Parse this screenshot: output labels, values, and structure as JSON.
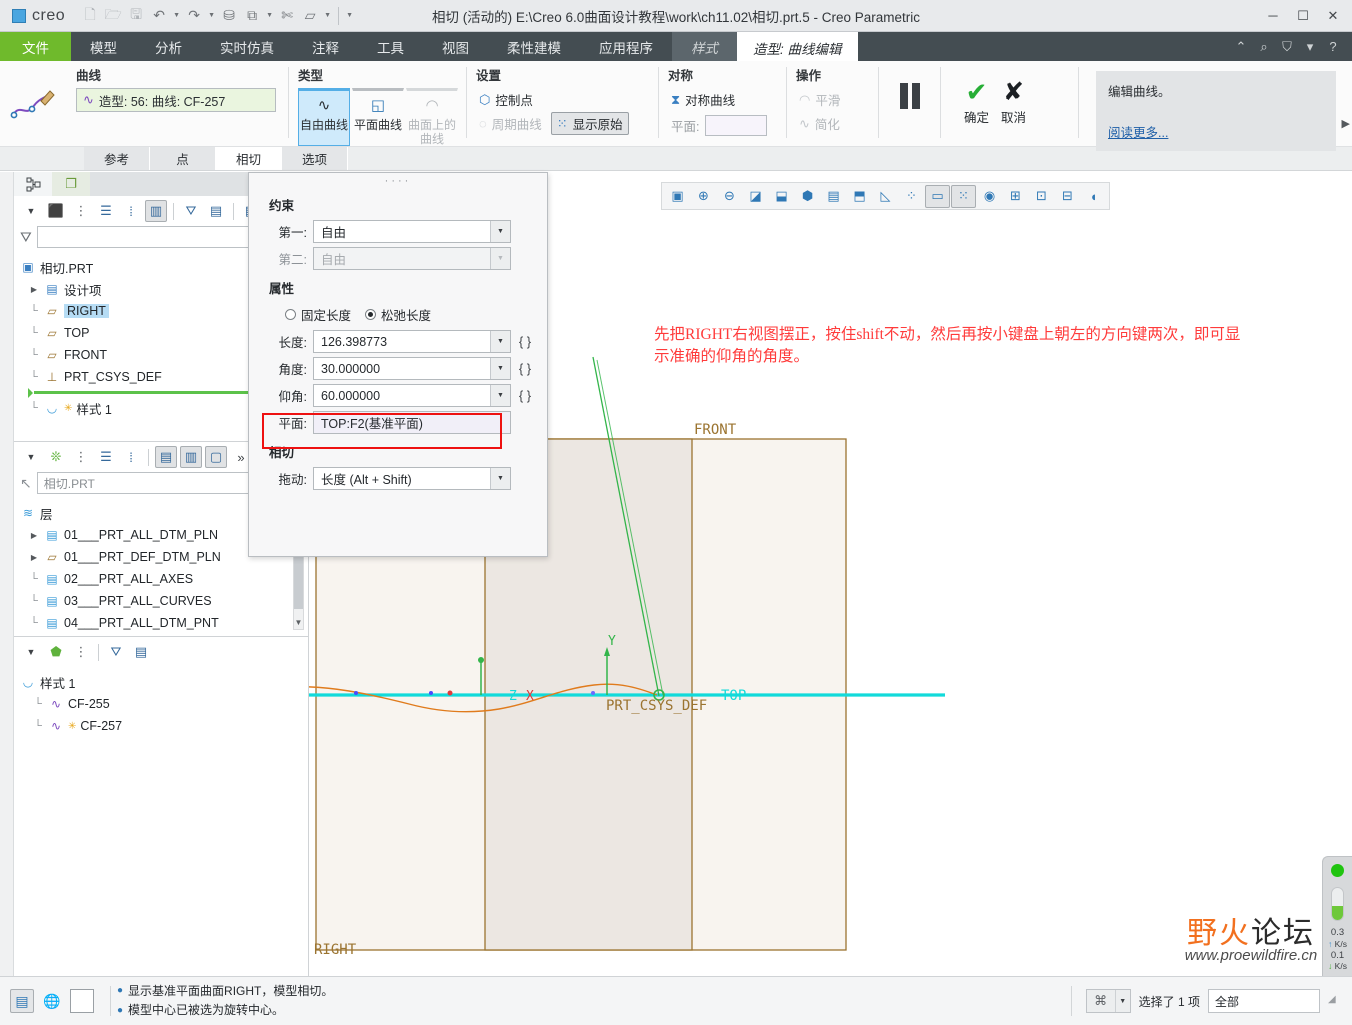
{
  "titlebar": {
    "brand": "creo",
    "title": "相切 (活动的) E:\\Creo 6.0曲面设计教程\\work\\ch11.02\\相切.prt.5 - Creo Parametric",
    "qat": [
      {
        "name": "new-file-icon",
        "glyph": "🗋"
      },
      {
        "name": "open-file-icon",
        "glyph": "🗁"
      },
      {
        "name": "save-icon",
        "glyph": "🖫"
      },
      {
        "name": "undo-icon",
        "glyph": "↶"
      },
      {
        "name": "redo-icon",
        "glyph": "↷"
      },
      {
        "name": "regenerate-icon",
        "glyph": "⛁"
      },
      {
        "name": "window-icon",
        "glyph": "⧉"
      },
      {
        "name": "close-window-icon",
        "glyph": "✄"
      },
      {
        "name": "appearance-icon",
        "glyph": "▱"
      }
    ],
    "window_controls": {
      "minimize": "─",
      "maximize": "☐",
      "close": "✕"
    }
  },
  "menubar": {
    "file": "文件",
    "items": [
      "模型",
      "分析",
      "实时仿真",
      "注释",
      "工具",
      "视图",
      "柔性建模",
      "应用程序"
    ],
    "style_tab": "样式",
    "context_tab": "造型: 曲线编辑",
    "right_icons": [
      "⌃",
      "⌕",
      "⛉",
      "▾",
      "?"
    ]
  },
  "ribbon": {
    "groups": {
      "curve": {
        "title": "曲线",
        "field_value": "造型: 56: 曲线: CF-257"
      },
      "type": {
        "title": "类型",
        "buttons": [
          {
            "label": "自由曲线",
            "icon": "∿",
            "state": "selected"
          },
          {
            "label": "平面曲线",
            "icon": "◱",
            "state": "normal"
          },
          {
            "label": "曲面上的曲线",
            "icon": "◠",
            "state": "disabled"
          }
        ]
      },
      "settings": {
        "title": "设置",
        "items": [
          {
            "label": "控制点",
            "icon": "⬡",
            "state": "normal"
          },
          {
            "label": "周期曲线",
            "icon": "◌",
            "state": "disabled"
          },
          {
            "label": "显示原始",
            "icon": "⦙",
            "state": "toggled"
          }
        ]
      },
      "symmetry": {
        "title": "对称",
        "item_label": "对称曲线",
        "plane_label": "平面:",
        "plane_value": ""
      },
      "operation": {
        "title": "操作",
        "items": [
          {
            "label": "平滑",
            "icon": "◠",
            "state": "disabled"
          },
          {
            "label": "简化",
            "icon": "∿",
            "state": "disabled"
          }
        ]
      },
      "confirm": {
        "ok_label": "确定",
        "cancel_label": "取消",
        "ok_glyph": "✔",
        "cancel_glyph": "✘"
      }
    },
    "help": {
      "text": "编辑曲线。",
      "link": "阅读更多..."
    }
  },
  "subtabs": {
    "items": [
      {
        "label": "参考",
        "selected": false
      },
      {
        "label": "点",
        "selected": false
      },
      {
        "label": "相切",
        "selected": true
      },
      {
        "label": "选项",
        "selected": false
      }
    ]
  },
  "leftpanel": {
    "tabs": [
      {
        "name": "model-tree-tab",
        "glyph": "⛓",
        "selected": true
      },
      {
        "name": "layer-tree-tab",
        "glyph": "❐",
        "selected": false
      }
    ],
    "tree_toolbar": [
      "▾",
      "⬛",
      "⋮",
      "☰",
      "⁞",
      "▥",
      "⛛",
      "▤",
      "▦"
    ],
    "filter_placeholder": "",
    "filter_clear": "✕",
    "model_tree": {
      "root": {
        "label": "相切.PRT",
        "icon": "part-icon"
      },
      "items": [
        {
          "label": "设计项",
          "icon": "design-items-icon",
          "expandable": true,
          "indent": 1
        },
        {
          "label": "RIGHT",
          "icon": "datum-plane-icon",
          "selected": true,
          "indent": 1
        },
        {
          "label": "TOP",
          "icon": "datum-plane-icon",
          "indent": 1
        },
        {
          "label": "FRONT",
          "icon": "datum-plane-icon",
          "indent": 1
        },
        {
          "label": "PRT_CSYS_DEF",
          "icon": "csys-icon",
          "indent": 1
        },
        {
          "label": "样式 1",
          "icon": "style-icon",
          "indent": 1,
          "modified": true
        }
      ]
    },
    "layer_panel": {
      "toolbar": [
        "▾",
        "❊",
        "⋮",
        "☰",
        "⁞",
        "▤",
        "▥",
        "▢",
        "»"
      ],
      "search_placeholder": "相切.PRT",
      "root": {
        "label": "层",
        "icon": "layers-icon"
      },
      "items": [
        {
          "label": "01___PRT_ALL_DTM_PLN",
          "expandable": true
        },
        {
          "label": "01___PRT_DEF_DTM_PLN",
          "expandable": true
        },
        {
          "label": "02___PRT_ALL_AXES",
          "expandable": false
        },
        {
          "label": "03___PRT_ALL_CURVES",
          "expandable": false
        },
        {
          "label": "04___PRT_ALL_DTM_PNT",
          "expandable": false
        }
      ]
    },
    "style_panel": {
      "toolbar": [
        "▾",
        "⬟",
        "⋮",
        "⛛",
        "▤"
      ],
      "root": {
        "label": "样式 1",
        "icon": "style-icon"
      },
      "items": [
        {
          "label": "CF-255",
          "icon": "curve-icon",
          "modified": false
        },
        {
          "label": "CF-257",
          "icon": "curve-icon",
          "modified": true
        }
      ]
    }
  },
  "dialog": {
    "sections": {
      "constraint": {
        "title": "约束",
        "first_label": "第一:",
        "first_value": "自由",
        "second_label": "第二:",
        "second_value": "自由"
      },
      "properties": {
        "title": "属性",
        "radio_fixed": "固定长度",
        "radio_relaxed": "松弛长度",
        "selected_radio": "relaxed",
        "length_label": "长度:",
        "length_value": "126.398773",
        "angle_label": "角度:",
        "angle_value": "30.000000",
        "elevation_label": "仰角:",
        "elevation_value": "60.000000",
        "plane_label": "平面:",
        "plane_value": "TOP:F2(基准平面)",
        "braces": "{ }"
      },
      "tangent": {
        "title": "相切",
        "drag_label": "拖动:",
        "drag_value": "长度 (Alt + Shift)"
      }
    },
    "highlight_color": "#ee1111"
  },
  "viewport": {
    "gfx_toolbar": [
      {
        "name": "zoom-area-icon",
        "glyph": "🔍"
      },
      {
        "name": "zoom-in-icon",
        "glyph": "⊕"
      },
      {
        "name": "zoom-out-icon",
        "glyph": "⊖"
      },
      {
        "name": "refit-icon",
        "glyph": "◪"
      },
      {
        "name": "reorient-icon",
        "glyph": "⬓"
      },
      {
        "name": "saved-views-icon",
        "glyph": "⬢"
      },
      {
        "name": "view-manager-icon",
        "glyph": "▤"
      },
      {
        "name": "display-style-icon",
        "glyph": "⬒"
      },
      {
        "name": "appearance-icon",
        "glyph": "◺"
      },
      {
        "name": "datum-display-icon",
        "glyph": "✛"
      },
      {
        "name": "annotation-display-icon",
        "glyph": "▭"
      },
      {
        "name": "point-display-icon",
        "glyph": "⁙"
      },
      {
        "name": "spin-center-icon",
        "glyph": "◉"
      },
      {
        "name": "grid-icon",
        "glyph": "⊞"
      },
      {
        "name": "section-icon",
        "glyph": "⊡"
      },
      {
        "name": "layer-display-icon",
        "glyph": "⊟"
      },
      {
        "name": "perspective-icon",
        "glyph": "⌒"
      }
    ],
    "annotation": "先把RIGHT右视图摆正，按住shift不动，然后再按小键盘上朝左的方向键两次，即可显示准确的仰角的角度。",
    "labels": {
      "front": "FRONT",
      "right": "RIGHT",
      "top": "TOP",
      "csys": "PRT_CSYS_DEF",
      "axis_x": "X",
      "axis_y": "Y",
      "axis_z": "Z"
    }
  },
  "network_widget": {
    "upload_rate": "0.3",
    "upload_unit": "K/s",
    "download_rate": "0.1",
    "download_unit": "K/s",
    "up_arrow": "↑",
    "down_arrow": "↓"
  },
  "watermark": {
    "line1_a": "野",
    "line1_b": "火",
    "line1_c": "论坛",
    "url": "www.proewildfire.cn"
  },
  "statusbar": {
    "icons": [
      {
        "name": "model-info-icon",
        "glyph": "▤"
      },
      {
        "name": "globe-icon",
        "glyph": "🌐"
      },
      {
        "name": "blank-panel-icon",
        "glyph": ""
      }
    ],
    "messages": [
      "显示基准平面曲面RIGHT，模型相切。",
      "模型中心已被选为旋转中心。"
    ],
    "selection_icon": "⌘",
    "selection_text": "选择了 1 项",
    "filter_value": "全部"
  }
}
